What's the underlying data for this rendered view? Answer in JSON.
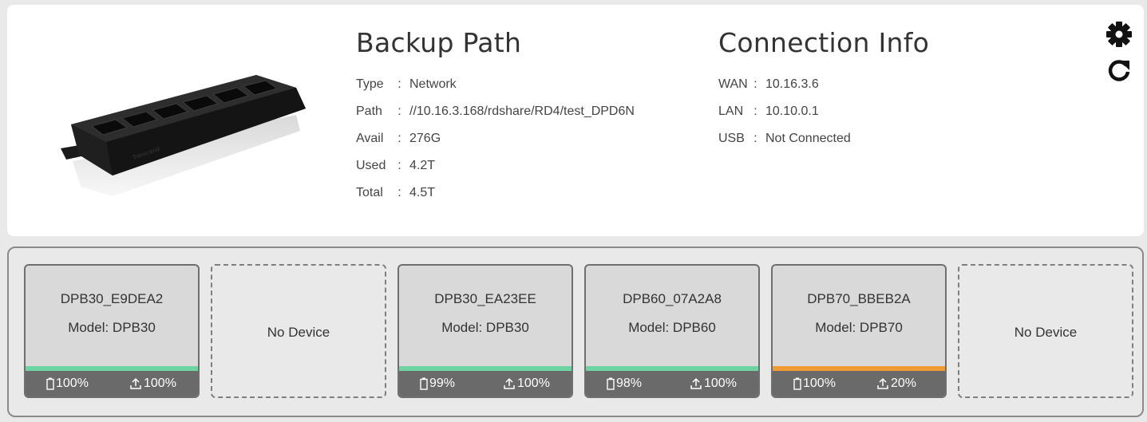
{
  "colors": {
    "bar_green": "#6dd3a1",
    "bar_orange": "#ef9a32",
    "status_bg": "#6a6a6a"
  },
  "backup": {
    "title": "Backup Path",
    "rows": [
      {
        "key": "Type",
        "value": "Network"
      },
      {
        "key": "Path",
        "value": "//10.16.3.168/rdshare/RD4/test_DPD6N"
      },
      {
        "key": "Avail",
        "value": "276G"
      },
      {
        "key": "Used",
        "value": "4.2T"
      },
      {
        "key": "Total",
        "value": "4.5T"
      }
    ]
  },
  "connection": {
    "title": "Connection Info",
    "rows": [
      {
        "key": "WAN",
        "value": "10.16.3.6"
      },
      {
        "key": "LAN",
        "value": "10.10.0.1"
      },
      {
        "key": "USB",
        "value": "Not Connected"
      }
    ]
  },
  "toolbar": {
    "settings_icon": "gear-icon",
    "refresh_icon": "refresh-icon"
  },
  "separator": ":",
  "slots": [
    {
      "name": "DPB30_E9DEA2",
      "model": "Model: DPB30",
      "battery": "100%",
      "upload": "100%",
      "progress": 1.0,
      "bar": "green"
    },
    {
      "empty": true,
      "label": "No Device"
    },
    {
      "name": "DPB30_EA23EE",
      "model": "Model: DPB30",
      "battery": "99%",
      "upload": "100%",
      "progress": 1.0,
      "bar": "green"
    },
    {
      "name": "DPB60_07A2A8",
      "model": "Model: DPB60",
      "battery": "98%",
      "upload": "100%",
      "progress": 1.0,
      "bar": "green"
    },
    {
      "name": "DPB70_BBEB2A",
      "model": "Model: DPB70",
      "battery": "100%",
      "upload": "20%",
      "progress": 1.0,
      "bar": "orange"
    },
    {
      "empty": true,
      "label": "No Device"
    }
  ]
}
